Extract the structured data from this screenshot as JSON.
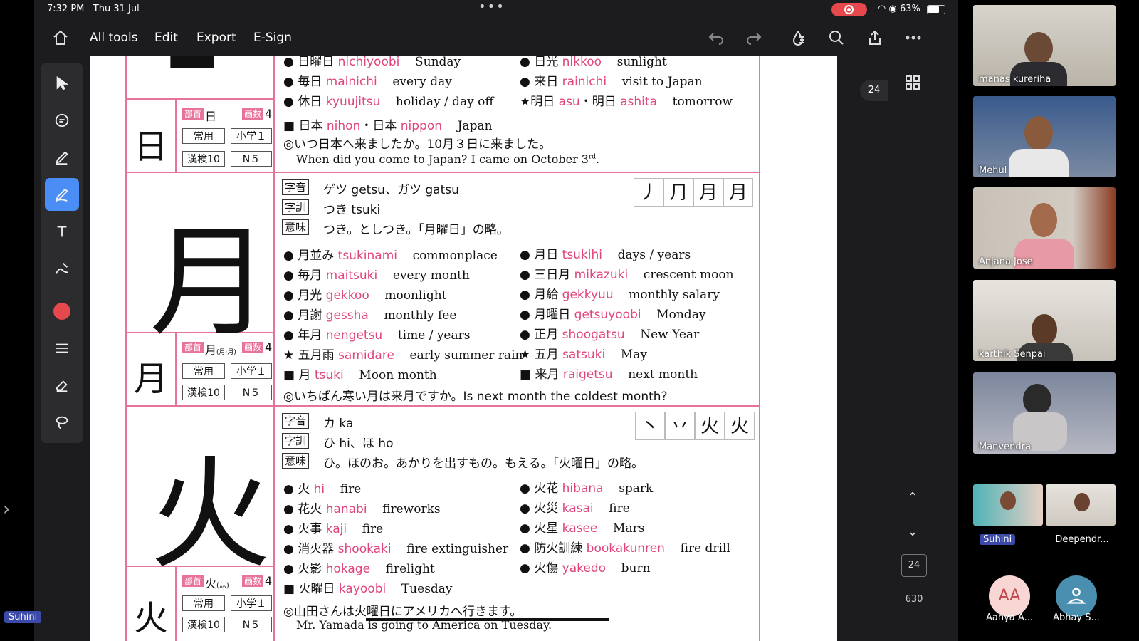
{
  "status": {
    "time": "7:32 PM",
    "date": "Thu 31 Jul",
    "battery": "63%"
  },
  "toolbar": {
    "all_tools": "All tools",
    "edit": "Edit",
    "export": "Export",
    "esign": "E-Sign"
  },
  "page": {
    "current": "24",
    "badge": "24",
    "total": "630"
  },
  "sidebar_label": "Suhini",
  "doc": {
    "r0": {
      "a_kanji": "日曜日",
      "a_rom": "nichiyoobi",
      "a_en": "Sunday",
      "b_kanji": "日光",
      "b_rom": "nikkoo",
      "b_en": "sunlight"
    },
    "r1": {
      "a_kanji": "毎日",
      "a_rom": "mainichi",
      "a_en": "every day",
      "b_kanji": "来日",
      "b_rom": "rainichi",
      "b_en": "visit to Japan"
    },
    "r2": {
      "a_kanji": "休日",
      "a_rom": "kyuujitsu",
      "a_en": "holiday / day off",
      "b_kanji": "明日",
      "b_rom": "asu",
      "b_dot": "・",
      "b_kanji2": "明日",
      "b_rom2": "ashita",
      "b_en": "tomorrow"
    },
    "r3": {
      "a_kanji": "日本",
      "a_rom": "nihon",
      "dot": "・",
      "a_kanji2": "日本",
      "a_rom2": "nippon",
      "a_en": "Japan"
    },
    "r4": "◎いつ日本へ来ましたか。10月３日に来ました。",
    "r5": "When did you come to Japan?  I came on October 3",
    "r5_sup": "rd",
    "r5_end": ".",
    "hi_small": "日",
    "hi_tags": {
      "bushu": "部首",
      "bushu_k": "日",
      "kakusuu": "画数",
      "kakusuu_n": "4",
      "jouyou": "常用",
      "shougaku": "小学１",
      "kanken": "漢検10",
      "jlpt": "N５"
    },
    "getsu": {
      "big": "月",
      "small": "月",
      "on_tag": "字音",
      "on": "ゲツ getsu、ガツ gatsu",
      "kun_tag": "字訓",
      "kun": "つき tsuki",
      "imi_tag": "意味",
      "imi": "つき。としつき。「月曜日」の略。",
      "strokes": [
        "丿",
        "⺆",
        "月",
        "月"
      ],
      "tags": {
        "bushu": "部首",
        "bushu_k": "月",
        "bushu_note": "(月·月)",
        "kakusuu": "画数",
        "kakusuu_n": "4",
        "jouyou": "常用",
        "shougaku": "小学１",
        "kanken": "漢検10",
        "jlpt": "N５"
      },
      "left": [
        {
          "k": "月並み",
          "r": "tsukinami",
          "e": "commonplace"
        },
        {
          "k": "毎月",
          "r": "maitsuki",
          "e": "every month"
        },
        {
          "k": "月光",
          "r": "gekkoo",
          "e": "moonlight"
        },
        {
          "k": "月謝",
          "r": "gessha",
          "e": "monthly fee"
        },
        {
          "k": "年月",
          "r": "nengetsu",
          "e": "time / years"
        },
        {
          "k": "五月雨",
          "r": "samidare",
          "e": "early summer rain"
        },
        {
          "k": "月",
          "r": "tsuki",
          "e": "Moon    month"
        }
      ],
      "right": [
        {
          "k": "月日",
          "r": "tsukihi",
          "e": "days / years"
        },
        {
          "k": "三日月",
          "r": "mikazuki",
          "e": "crescent moon"
        },
        {
          "k": "月給",
          "r": "gekkyuu",
          "e": "monthly salary"
        },
        {
          "k": "月曜日",
          "r": "getsuyoobi",
          "e": "Monday"
        },
        {
          "k": "正月",
          "r": "shoogatsu",
          "e": "New Year"
        },
        {
          "k": "五月",
          "r": "satsuki",
          "e": "May"
        },
        {
          "k": "来月",
          "r": "raigetsu",
          "e": "next month"
        }
      ],
      "example": "◎いちばん寒い月は来月ですか。Is next month the coldest month?"
    },
    "ka": {
      "big": "火",
      "small": "火",
      "on_tag": "字音",
      "on": "カ ka",
      "kun_tag": "字訓",
      "kun": "ひ hi、ほ ho",
      "imi_tag": "意味",
      "imi": "ひ。ほのお。あかりを出すもの。もえる。「火曜日」の略。",
      "strokes": [
        "丶",
        "丷",
        "火",
        "火"
      ],
      "tags": {
        "bushu": "部首",
        "bushu_k": "火",
        "bushu_note": "(灬)",
        "kakusuu": "画数",
        "kakusuu_n": "4",
        "jouyou": "常用",
        "shougaku": "小学１",
        "kanken": "漢検10",
        "jlpt": "N５"
      },
      "left": [
        {
          "k": "火",
          "r": "hi",
          "e": "fire"
        },
        {
          "k": "花火",
          "r": "hanabi",
          "e": "fireworks"
        },
        {
          "k": "火事",
          "r": "kaji",
          "e": "fire"
        },
        {
          "k": "消火器",
          "r": "shookaki",
          "e": "fire extinguisher"
        },
        {
          "k": "火影",
          "r": "hokage",
          "e": "firelight"
        },
        {
          "k": "火曜日",
          "r": "kayoobi",
          "e": "Tuesday"
        }
      ],
      "right": [
        {
          "k": "火花",
          "r": "hibana",
          "e": "spark"
        },
        {
          "k": "火災",
          "r": "kasai",
          "e": "fire"
        },
        {
          "k": "火星",
          "r": "kasee",
          "e": "Mars"
        },
        {
          "k": "防火訓練",
          "r": "bookakunren",
          "e": "fire drill"
        },
        {
          "k": "火傷",
          "r": "yakedo",
          "e": "burn"
        }
      ],
      "example": "◎山田さんは火曜日にアメリカへ行きます。",
      "example_en": "Mr. Yamada is going to America on Tuesday."
    }
  },
  "participants": [
    {
      "name": "manas kureriha"
    },
    {
      "name": "Mehul"
    },
    {
      "name": "Anjana Jose"
    },
    {
      "name": "karthik Senpai"
    },
    {
      "name": "Manvendra"
    }
  ],
  "bottom_participants": [
    {
      "name": "Suhini"
    },
    {
      "name": "Deependr..."
    },
    {
      "name": "Aanya A...",
      "initials": "AA"
    },
    {
      "name": "Abhay S..."
    }
  ]
}
